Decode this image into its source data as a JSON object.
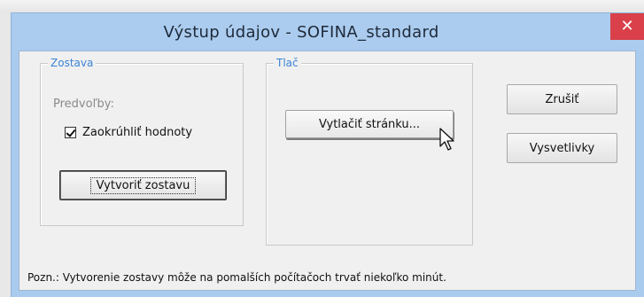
{
  "window": {
    "title": "Výstup údajov  -  SOFINA_standard",
    "close_glyph": "✕"
  },
  "zostava": {
    "label": "Zostava",
    "predvolby_label": "Predvoľby:",
    "round_checkbox_label": "Zaokrúhliť hodnoty",
    "round_checked": true,
    "create_button": "Vytvoriť zostavu"
  },
  "tlac": {
    "label": "Tlač",
    "print_page_button": "Vytlačiť stránku..."
  },
  "actions": {
    "cancel_button": "Zrušiť",
    "help_button": "Vysvetlivky"
  },
  "note": "Pozn.: Vytvorenie zostavy môže na pomalších počítačoch trvať niekoľko minút.",
  "colors": {
    "titlebar": "#abccef",
    "close": "#d9404a",
    "group_label": "#3c83d6"
  },
  "icons": {
    "cursor": "arrow-cursor-icon"
  }
}
